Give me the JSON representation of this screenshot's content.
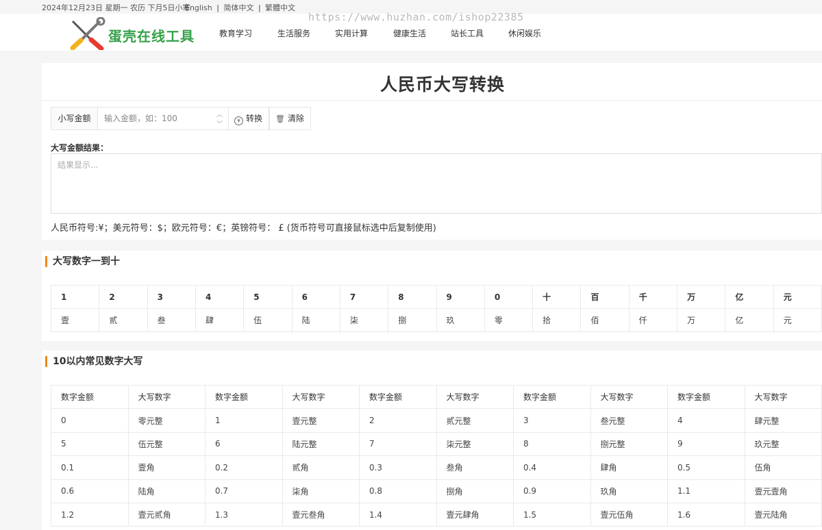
{
  "topbar": {
    "date": "2024年12月23日 星期一 农历 下月5日小寒",
    "lang_en": "English",
    "lang_sc": "简体中文",
    "lang_tc": "繁體中文",
    "watermark": "https://www.huzhan.com/ishop22385"
  },
  "header": {
    "logo_text": "蛋壳在线工具",
    "nav": [
      "教育学习",
      "生活服务",
      "实用计算",
      "健康生活",
      "站长工具",
      "休闲娱乐"
    ]
  },
  "converter": {
    "title": "人民币大写转换",
    "input_label": "小写金额",
    "input_placeholder": "输入金额，如：100",
    "convert_label": "转换",
    "clear_label": "清除",
    "result_label": "大写金额结果：",
    "result_placeholder": "结果显示...",
    "symbols_note": "人民币符号:¥；美元符号：$；欧元符号：€；英镑符号： £ (货币符号可直接鼠标选中后复制使用)"
  },
  "digits_section": {
    "title": "大写数字一到十",
    "row_numbers": [
      "1",
      "2",
      "3",
      "4",
      "5",
      "6",
      "7",
      "8",
      "9",
      "0",
      "十",
      "百",
      "千",
      "万",
      "亿",
      "元"
    ],
    "row_upper": [
      "壹",
      "贰",
      "叁",
      "肆",
      "伍",
      "陆",
      "柒",
      "捌",
      "玖",
      "零",
      "拾",
      "佰",
      "仟",
      "万",
      "亿",
      "元"
    ]
  },
  "common_section": {
    "title": "10以内常见数字大写",
    "headers": [
      "数字金额",
      "大写数字",
      "数字金额",
      "大写数字",
      "数字金额",
      "大写数字",
      "数字金额",
      "大写数字",
      "数字金额",
      "大写数字"
    ],
    "rows": [
      [
        "0",
        "零元整",
        "1",
        "壹元整",
        "2",
        "贰元整",
        "3",
        "叁元整",
        "4",
        "肆元整"
      ],
      [
        "5",
        "伍元整",
        "6",
        "陆元整",
        "7",
        "柒元整",
        "8",
        "捌元整",
        "9",
        "玖元整"
      ],
      [
        "0.1",
        "壹角",
        "0.2",
        "贰角",
        "0.3",
        "叁角",
        "0.4",
        "肆角",
        "0.5",
        "伍角"
      ],
      [
        "0.6",
        "陆角",
        "0.7",
        "柒角",
        "0.8",
        "捌角",
        "0.9",
        "玖角",
        "1.1",
        "壹元壹角"
      ],
      [
        "1.2",
        "壹元贰角",
        "1.3",
        "壹元叁角",
        "1.4",
        "壹元肆角",
        "1.5",
        "壹元伍角",
        "1.6",
        "壹元陆角"
      ]
    ]
  }
}
